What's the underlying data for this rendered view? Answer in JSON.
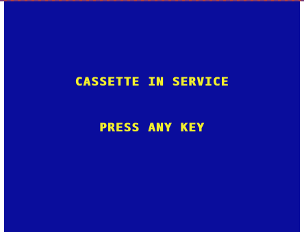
{
  "screen": {
    "background_color": "#0a0d9c",
    "text_color": "#f2ef2c",
    "message_line1": "CASSETTE IN SERVICE",
    "message_line2": "PRESS ANY KEY"
  }
}
